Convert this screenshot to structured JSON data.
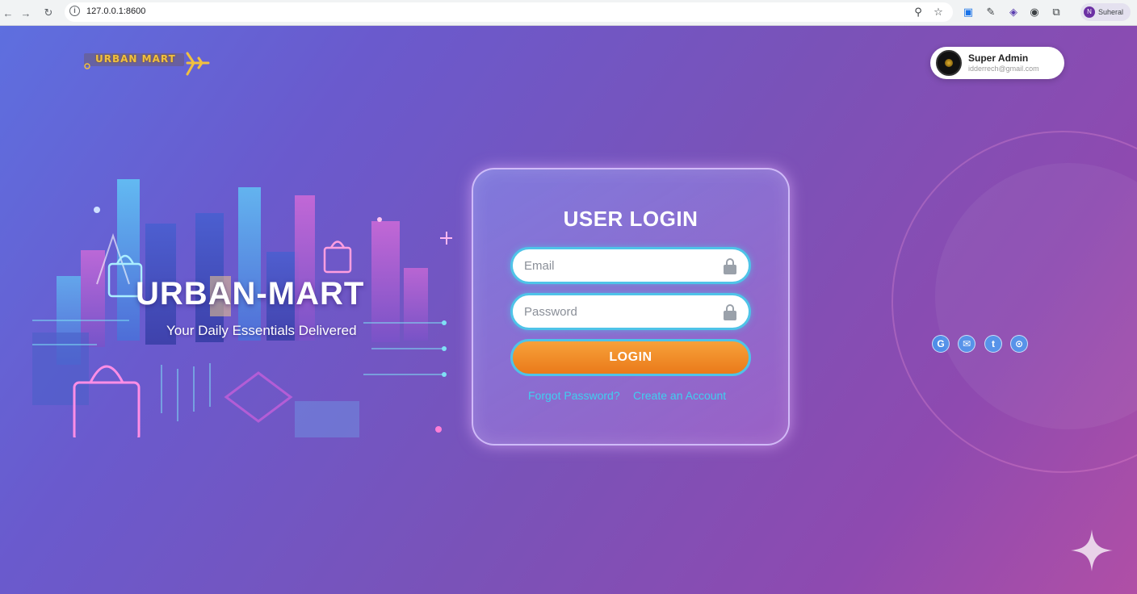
{
  "browser": {
    "url": "127.0.0.1:8600",
    "profile_name": "Suheral",
    "profile_initial": "N"
  },
  "header": {
    "logo_text": "URBAN MART",
    "user": {
      "name": "Super Admin",
      "email": "idderrech@gmail.com"
    }
  },
  "hero": {
    "title": "URBAN-MART",
    "tagline": "Your Daily Essentials Delivered"
  },
  "login": {
    "title": "USER LOGIN",
    "email_placeholder": "Email",
    "password_placeholder": "Password",
    "button_label": "LOGIN",
    "forgot_label": "Forgot Password?",
    "create_label": "Create an Account"
  },
  "social": [
    {
      "icon": "google-icon",
      "glyph": "G"
    },
    {
      "icon": "mail-icon",
      "glyph": "✉"
    },
    {
      "icon": "twitter-icon",
      "glyph": "t"
    },
    {
      "icon": "lock-icon",
      "glyph": "⊙"
    }
  ],
  "colors": {
    "accent": "#4fc3e8",
    "button": "#f08a2a",
    "link": "#3fd0f0"
  }
}
